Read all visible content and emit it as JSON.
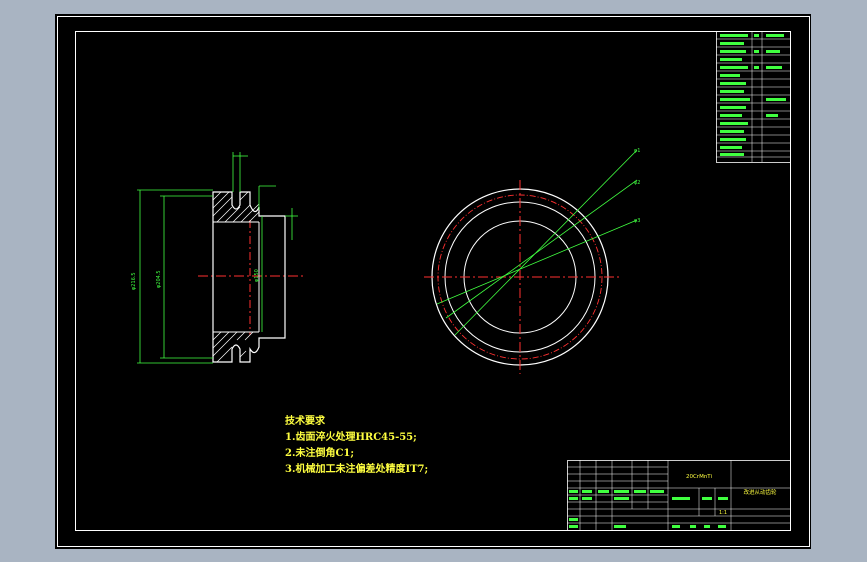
{
  "technical_requirements": {
    "heading": "技术要求",
    "items": [
      "1.齿面淬火处理HRC45-55;",
      "2.未注倒角C1;",
      "3.机械加工未注偏差处精度IT7;"
    ]
  },
  "title_block": {
    "material": "20CrMnTi",
    "drawing_name": "改进从动齿轮",
    "scale": "1:1"
  },
  "colors": {
    "background": "#a9b4c2",
    "sheet": "#000000",
    "frame": "#ffffff",
    "outline": "#ffffff",
    "centerline": "#ff3030",
    "dimension": "#40ff40",
    "text": "#ffff40"
  }
}
